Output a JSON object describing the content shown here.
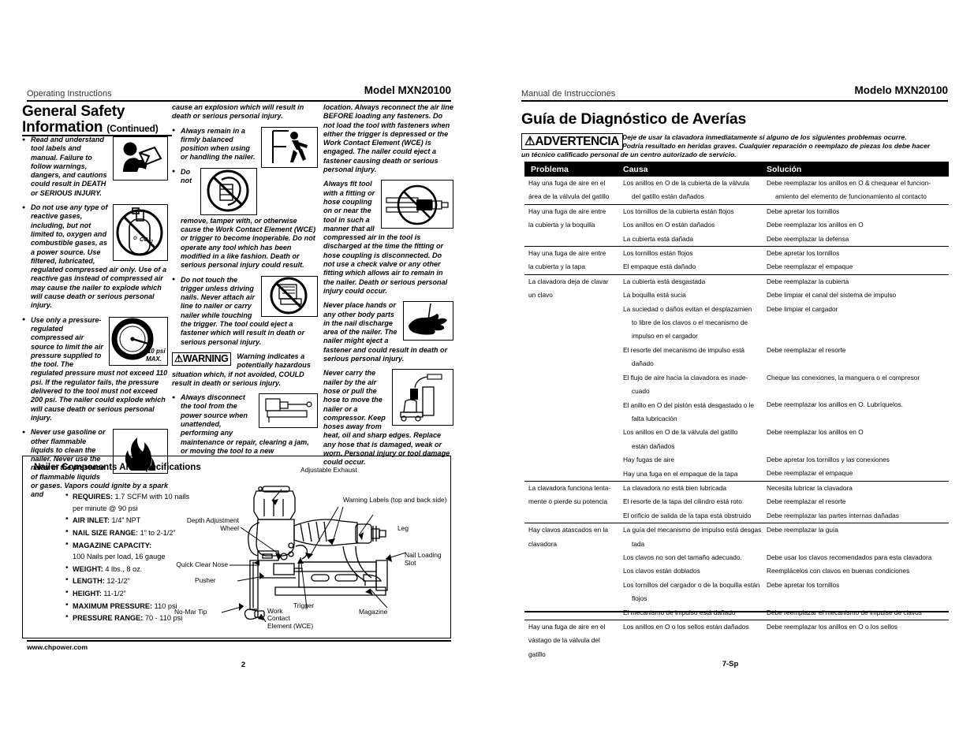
{
  "left": {
    "header_left": "Operating Instructions",
    "header_right": "Model MXN20100",
    "title": "General Safety Information",
    "title_suffix": "(Continued)",
    "col1": {
      "b1": "Read and understand tool labels and manual. Failure to follow warnings, dangers, and cautions could result in DEATH or SERIOUS INJURY.",
      "b2": "Do not use any type of reactive gases, including, but not limited to, oxygen and combustible gases, as a power source. Use filtered, lubricated, regulated compressed air only. Use of a reactive gas instead of compressed air may cause the nailer to explode which will cause death or serious personal injury.",
      "b3": "Use only a pressure-regulated compressed air source to limit the air pressure supplied to the tool. The regulated pressure must not exceed 110 psi. If the regulator fails, the pressure delivered to the tool must not exceed 200 psi. The nailer could explode which will cause death or serious personal injury.",
      "b4": "Never use gasoline or other flammable liquids to clean the nailer. Never use the nailer in the presence of flammable liquids or gases. Vapors could ignite by a spark and"
    },
    "col2": {
      "p0": "cause an explosion which will result in death or serious personal injury.",
      "b1": "Always remain in a firmly balanced position when using or handling the nailer.",
      "b2": "Do not remove, tamper with, or otherwise cause the Work Contact Element (WCE) or trigger to become inoperable. Do not operate any tool which has been modified in a like fashion. Death or serious personal injury could result.",
      "b3": "Do not touch the trigger unless driving nails.  Never attach air line to nailer or carry nailer while touching the trigger. The tool could eject a fastener which will result in death or serious personal injury.",
      "warn_stamp": "⚠WARNING",
      "warn_text": "Warning indicates a potentially hazardous situation which, if not avoided, COULD result in death or serious injury.",
      "b4": "Always disconnect the tool from the power source when unattended, performing any maintenance or repair, clearing a jam, or moving the tool to a new"
    },
    "col3": {
      "p0": "location. Always reconnect the air line BEFORE loading any fasteners. Do not load the tool with fasteners when either the trigger is depressed or the Work Contact Element (WCE) is engaged. The nailer could eject a fastener causing death or serious personal injury.",
      "p1": "Always fit tool with a fitting or hose coupling on or near the tool in such a manner that all compressed air in the tool is discharged at the time the fitting or hose coupling is disconnected. Do not use a check valve or any other fitting which allows air to remain in the nailer. Death or serious personal injury could occur.",
      "p2": "Never place hands or any other body parts in the nail discharge area of the nailer. The nailer might eject a fastener and could result in death or serious personal injury.",
      "p3": "Never carry the nailer by the air hose or pull the hose to move the nailer or a compressor. Keep hoses away from heat, oil and sharp edges. Replace any hose that is damaged, weak or worn. Personal injury or tool damage could occur."
    },
    "spec": {
      "title": "Nailer Components And Specifications",
      "items": [
        {
          "label": "REQUIRES:",
          "value": "1.7 SCFM with 10 nails",
          "value2": "per minute @ 90 psi"
        },
        {
          "label": "AIR INLET:",
          "value": "1/4” NPT"
        },
        {
          "label": "NAIL SIZE RANGE:",
          "value": "1” to 2-1/2”"
        },
        {
          "label": "MAGAZINE CAPACITY:",
          "value": "",
          "value2": "100 Nails per load, 16 gauge"
        },
        {
          "label": "WEIGHT:",
          "value": "4 lbs., 8 oz."
        },
        {
          "label": "LENGTH:",
          "value": "12-1/2\""
        },
        {
          "label": "HEIGHT:",
          "value": "11-1/2”"
        },
        {
          "label": "MAXIMUM PRESSURE:",
          "value": "110 psi"
        },
        {
          "label": "PRESSURE RANGE:",
          "value": "70 - 110 psi"
        }
      ]
    },
    "diagram_labels": {
      "adjustable_exhaust": "Adjustable Exhaust",
      "warning_labels": "Warning Labels (top and back side)",
      "depth_adjustment": "Depth Adjustment\nWheel",
      "leg": "Leg",
      "nail_loading_slot": "Nail Loading\nSlot",
      "quick_clear_nose": "Quick Clear Nose",
      "pusher": "Pusher",
      "no_mar_tip": "No-Mar Tip",
      "work_contact": "Work\nContact\nElement (WCE)",
      "trigger": "Trigger",
      "magazine": "Magazine"
    },
    "footer_url": "www.chpower.com",
    "page_number": "2"
  },
  "right": {
    "header_left": "Manual de Instrucciones",
    "header_right": "Modelo MXN20100",
    "title": "Guía de Diagnóstico de Averías",
    "warn_stamp": "⚠ADVERTENCIA",
    "warn_line1": "Deje de usar la clavadora inmediatamente si alguno de los siguientes problemas ocurre.",
    "warn_line2": "Podría resultado en heridas graves. Cualquier reparación o reemplazo de piezas los debe hacer",
    "warn_line3": "un técnico calificado personal de un centro autorizado de servicio.",
    "table": {
      "columns": [
        "Problema",
        "Causa",
        "Solución"
      ],
      "rows": [
        {
          "problem": [
            "Hay una fuga de aire en el",
            "área de la válvula del gatillo"
          ],
          "causes": [
            "Los anillos en O de la cubierta de la válvula",
            "→del gatillo están dañados"
          ],
          "solutions": [
            "Debe reemplazar los anillos en O & chequear el funcion-",
            "→amiento del elemento de funcionamiento al contacto"
          ]
        },
        {
          "problem": [
            "Hay una fuga de aire entre",
            "la cubierta y la boquilla"
          ],
          "causes": [
            "Los tornillos de la cubierta están flojos",
            "Los anillos en O están dañados",
            "La cubierta está dañada"
          ],
          "solutions": [
            "Debe apretar los tornillos",
            "Debe reemplazar los anillos en O",
            "Debe reemplazar la defensa"
          ]
        },
        {
          "problem": [
            "Hay una fuga de aire entre",
            "la cubierta y la tapa"
          ],
          "causes": [
            "Los tornillos están flojos",
            "El empaque está dañado"
          ],
          "solutions": [
            "Debe apretar los tornillos",
            "Debe reemplazar el empaque"
          ]
        },
        {
          "problem": [
            "La clavadora deja de clavar",
            "un clavo"
          ],
          "causes": [
            "La cubierta está desgastada",
            "La boquilla está sucia",
            "La suciedad o daños evitan el desplazamien",
            "→to libre de los clavos o el mecanismo de",
            "→impulso en el cargador",
            "El resorte del mecanismo de impulso está",
            "→dañado",
            "El flujo de aire hacia la clavadora es inade-",
            "→cuado",
            "El anillo en O del pistón está desgastado o le",
            "→falta lubricación",
            "Los anillos en O de la válvula del gatillo",
            "→están dañados",
            "Hay fugas de aire",
            "Hay una fuga en el empaque de la tapa"
          ],
          "solutions": [
            "Debe reemplazar la cubierta",
            "Debe limpiar el canal del sistema de impulso",
            "Debe limpiar el cargador",
            "",
            "",
            "Debe reemplazar el resorte",
            "",
            "Cheque las conexiones, la manguera o el compresor",
            "",
            "Debe reemplazar los anillos en O. Lubríquelos.",
            "",
            "Debe reemplazar los anillos en O",
            "",
            "Debe apretar los tornillos y las conexiones",
            "Debe reemplazar el empaque"
          ]
        },
        {
          "problem": [
            "La clavadora funciona lenta-",
            "mente o pierde su potencia"
          ],
          "causes": [
            "La clavadora no está bien lubricada",
            "El resorte de la tapa del cilindro está roto",
            "El orificio de salida de la tapa está obstruido"
          ],
          "solutions": [
            "Necesita lubricar la clavadora",
            "Debe reemplazar el resorte",
            "Debe reemplazar las partes internas dañadas"
          ]
        },
        {
          "problem": [
            "Hay clavos atascados en la",
            "clavadora"
          ],
          "causes": [
            "La guía del mecanismo de impulso está desgas",
            "→tada",
            "Los clavos no son del tamaño adecuado.",
            "Los clavos están doblados",
            "Los tornillos del cargador o de la boquilla están",
            "→flojos",
            "El mecanismo de impulso está dañado"
          ],
          "solutions": [
            "Debe reemplazar la guía",
            "",
            "Debe usar los clavos recomendados para esta clavadora",
            "Reemplácelos con clavos en buenas condiciones",
            "Debe apretar los tornillos",
            "",
            "Debe reemplazar el mecanismo de impulse de clavos"
          ]
        },
        {
          "problem": [
            "Hay una fuga de aire en el",
            "vástago de la válvula del",
            "gatillo"
          ],
          "causes": [
            "Los anillos en O o los sellos están dañados"
          ],
          "solutions": [
            "Debe reemplazar los anillos en O o los sellos"
          ]
        }
      ]
    },
    "page_number": "7-Sp"
  },
  "colors": {
    "ink": "#000000",
    "header_gray": "#333333",
    "table_header_bg": "#000000"
  }
}
